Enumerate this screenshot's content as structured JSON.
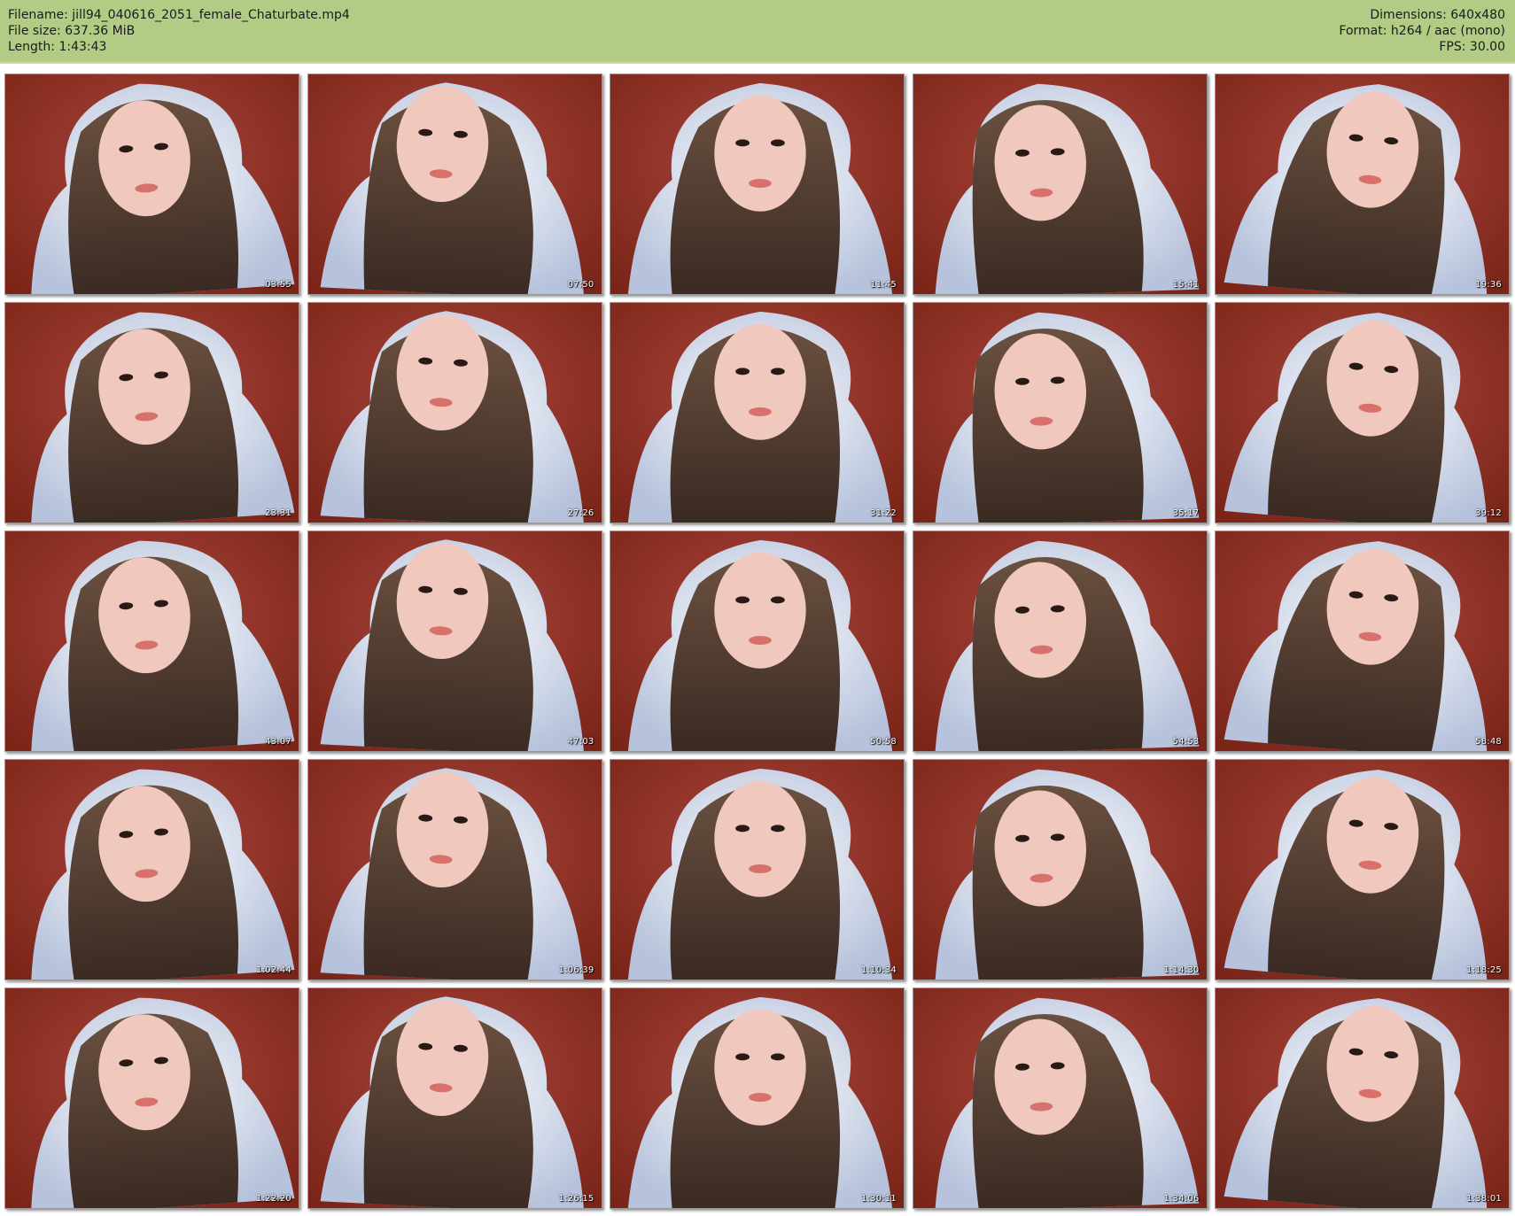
{
  "header": {
    "filename": "Filename: jill94_040616_2051_female_Chaturbate.mp4",
    "filesize": "File size: 637.36 MiB",
    "length": "Length: 1:43:43",
    "dimensions": "Dimensions: 640x480",
    "format": "Format: h264 / aac (mono)",
    "fps": "FPS: 30.00"
  },
  "colors": {
    "header_bg": "#b2cc85",
    "backdrop": "#7a2418",
    "hood": "#e8eef8",
    "hair": "#3a2a22",
    "skin": "#f0c8be"
  },
  "frames": [
    {
      "time": "03:55"
    },
    {
      "time": "07:50"
    },
    {
      "time": "11:45"
    },
    {
      "time": "15:41"
    },
    {
      "time": "19:36"
    },
    {
      "time": "23:31"
    },
    {
      "time": "27:26"
    },
    {
      "time": "31:22"
    },
    {
      "time": "35:17"
    },
    {
      "time": "39:12"
    },
    {
      "time": "43:07"
    },
    {
      "time": "47:03"
    },
    {
      "time": "50:58"
    },
    {
      "time": "54:53"
    },
    {
      "time": "58:48"
    },
    {
      "time": "1:02:44"
    },
    {
      "time": "1:06:39"
    },
    {
      "time": "1:10:34"
    },
    {
      "time": "1:14:30"
    },
    {
      "time": "1:18:25"
    },
    {
      "time": "1:22:20"
    },
    {
      "time": "1:26:15"
    },
    {
      "time": "1:30:11"
    },
    {
      "time": "1:34:06"
    },
    {
      "time": "1:38:01"
    }
  ]
}
